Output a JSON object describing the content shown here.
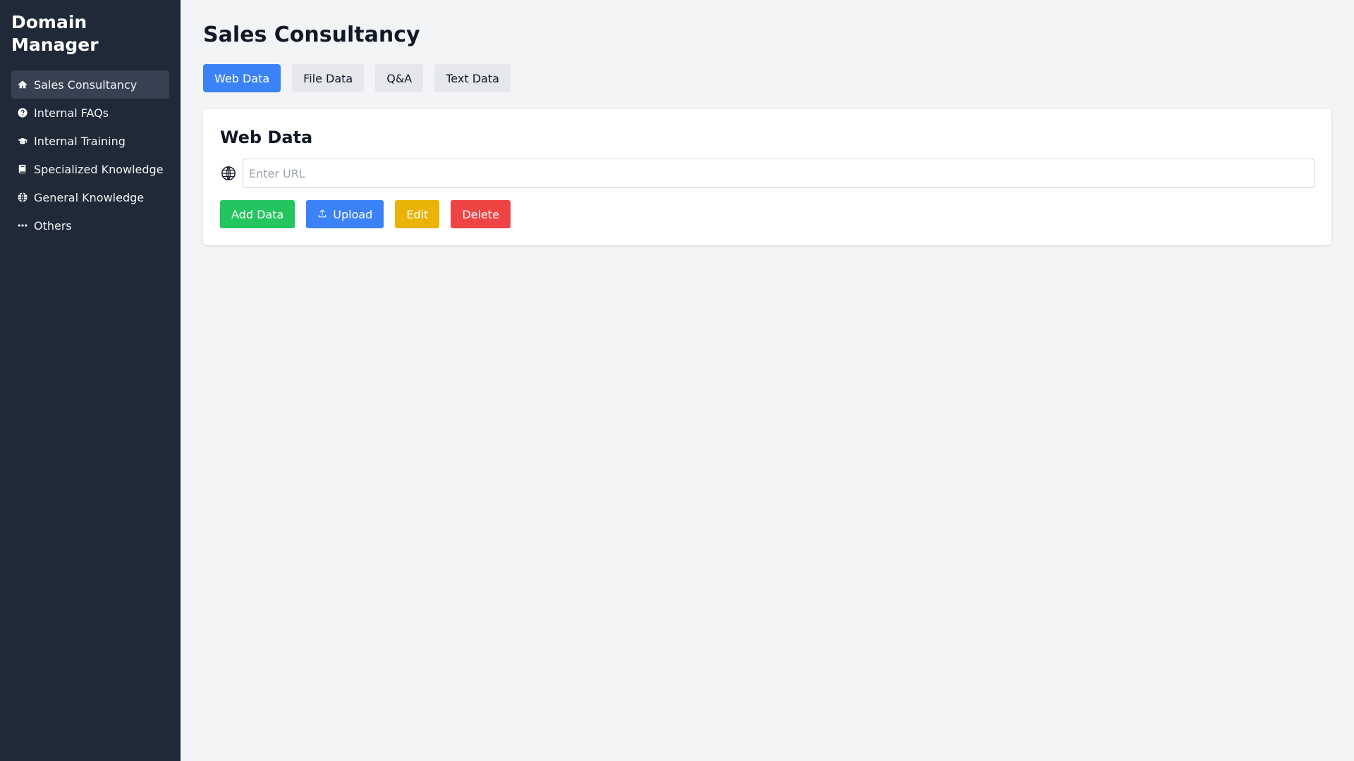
{
  "sidebar": {
    "title": "Domain Manager",
    "items": [
      {
        "label": "Sales Consultancy",
        "icon": "home-icon",
        "active": true
      },
      {
        "label": "Internal FAQs",
        "icon": "question-circle-icon"
      },
      {
        "label": "Internal Training",
        "icon": "graduation-cap-icon"
      },
      {
        "label": "Specialized Knowledge",
        "icon": "book-icon"
      },
      {
        "label": "General Knowledge",
        "icon": "globe-icon"
      },
      {
        "label": "Others",
        "icon": "ellipsis-icon"
      }
    ]
  },
  "main": {
    "title": "Sales Consultancy",
    "tabs": [
      {
        "label": "Web Data",
        "active": true
      },
      {
        "label": "File Data"
      },
      {
        "label": "Q&A"
      },
      {
        "label": "Text Data"
      }
    ],
    "card": {
      "title": "Web Data",
      "url_input": {
        "placeholder": "Enter URL",
        "value": "",
        "icon": "globe-icon"
      },
      "buttons": {
        "add": "Add Data",
        "upload": "Upload",
        "edit": "Edit",
        "delete": "Delete"
      }
    }
  },
  "colors": {
    "sidebar_bg": "#1f2937",
    "active_nav": "#374151",
    "primary": "#3b82f6",
    "success": "#22c55e",
    "warning": "#eab308",
    "danger": "#ef4444"
  }
}
